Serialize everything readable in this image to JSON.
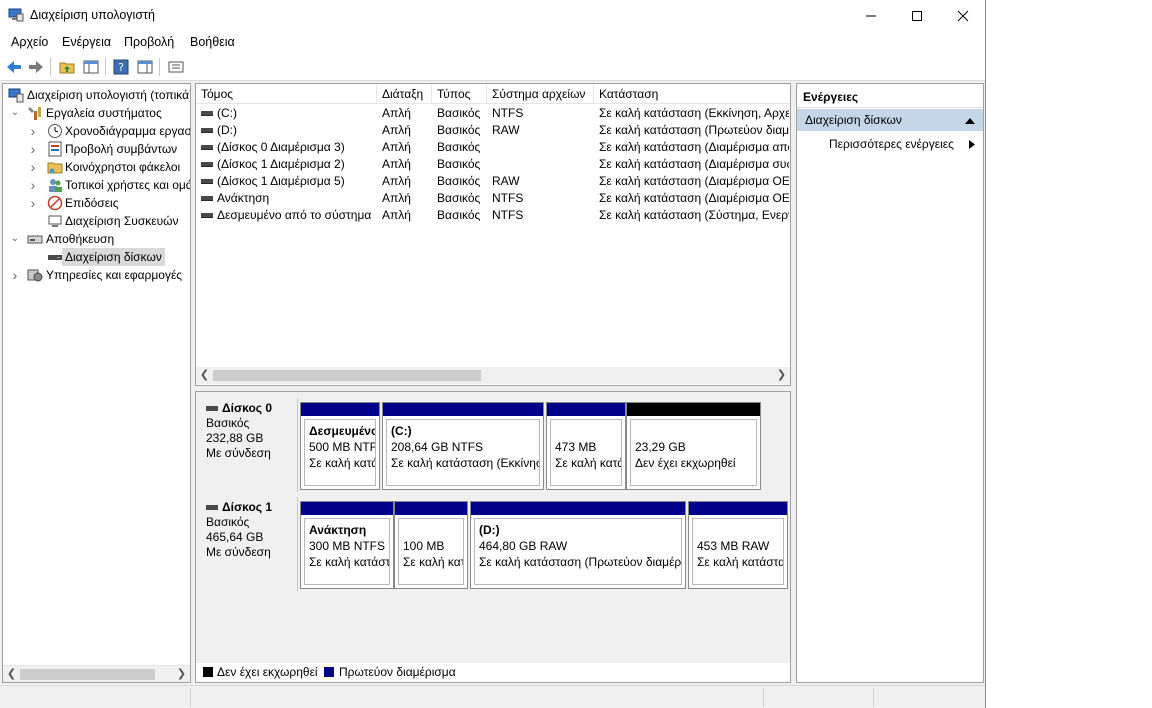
{
  "window": {
    "title": "Διαχείριση υπολογιστή"
  },
  "menu": [
    "Αρχείο",
    "Ενέργεια",
    "Προβολή",
    "Βοήθεια"
  ],
  "tree": [
    {
      "label": "Διαχείριση υπολογιστή (τοπικά)",
      "level": 0,
      "chevron": "",
      "icon": "computer-management-icon"
    },
    {
      "label": "Εργαλεία συστήματος",
      "level": 1,
      "chevron": "down",
      "icon": "tools-icon"
    },
    {
      "label": "Χρονοδιάγραμμα εργασιών",
      "level": 2,
      "chevron": "right",
      "icon": "clock-icon"
    },
    {
      "label": "Προβολή συμβάντων",
      "level": 2,
      "chevron": "right",
      "icon": "event-viewer-icon"
    },
    {
      "label": "Κοινόχρηστοι φάκελοι",
      "level": 2,
      "chevron": "right",
      "icon": "shared-folder-icon"
    },
    {
      "label": "Τοπικοί χρήστες και ομάδες",
      "level": 2,
      "chevron": "right",
      "icon": "users-icon"
    },
    {
      "label": "Επιδόσεις",
      "level": 2,
      "chevron": "right",
      "icon": "performance-icon"
    },
    {
      "label": "Διαχείριση Συσκευών",
      "level": 2,
      "chevron": "",
      "icon": "device-manager-icon"
    },
    {
      "label": "Αποθήκευση",
      "level": 1,
      "chevron": "down",
      "icon": "storage-icon"
    },
    {
      "label": "Διαχείριση δίσκων",
      "level": 2,
      "chevron": "",
      "icon": "disk-icon",
      "selected": true
    },
    {
      "label": "Υπηρεσίες και εφαρμογές",
      "level": 1,
      "chevron": "right",
      "icon": "services-icon"
    }
  ],
  "volumes": {
    "columns": [
      "Τόμος",
      "Διάταξη",
      "Τύπος",
      "Σύστημα αρχείων",
      "Κατάσταση"
    ],
    "rows": [
      [
        "(C:)",
        "Απλή",
        "Βασικός",
        "NTFS",
        "Σε καλή κατάσταση (Εκκίνηση, Αρχε"
      ],
      [
        "(D:)",
        "Απλή",
        "Βασικός",
        "RAW",
        "Σε καλή κατάσταση (Πρωτεύον διαμ"
      ],
      [
        "(Δίσκος 0 Διαμέρισμα 3)",
        "Απλή",
        "Βασικός",
        "",
        "Σε καλή κατάσταση (Διαμέρισμα απο"
      ],
      [
        "(Δίσκος 1 Διαμέρισμα 2)",
        "Απλή",
        "Βασικός",
        "",
        "Σε καλή κατάσταση (Διαμέρισμα συσ"
      ],
      [
        "(Δίσκος 1 Διαμέρισμα 5)",
        "Απλή",
        "Βασικός",
        "RAW",
        "Σε καλή κατάσταση (Διαμέρισμα OEI"
      ],
      [
        "Ανάκτηση",
        "Απλή",
        "Βασικός",
        "NTFS",
        "Σε καλή κατάσταση (Διαμέρισμα OEI"
      ],
      [
        "Δεσμευμένο από το σύστημα",
        "Απλή",
        "Βασικός",
        "NTFS",
        "Σε καλή κατάσταση (Σύστημα, Ενεργ"
      ]
    ]
  },
  "disks": [
    {
      "name": "Δίσκος 0",
      "type": "Βασικός",
      "size": "232,88 GB",
      "status": "Με σύνδεση",
      "partitions": [
        {
          "name": "Δεσμευμένο",
          "line1": "500 MB NTFS",
          "line2": "Σε καλή κατάσταση",
          "bar": "#00008b"
        },
        {
          "name": "(C:)",
          "line1": "208,64 GB NTFS",
          "line2": "Σε καλή κατάσταση (Εκκίνηση",
          "bar": "#00008b"
        },
        {
          "name": "",
          "line1": "473 MB",
          "line2": "Σε καλή κατάσταση",
          "bar": "#00008b"
        },
        {
          "name": "",
          "line1": "23,29 GB",
          "line2": "Δεν έχει εκχωρηθεί",
          "bar": "#000000"
        }
      ]
    },
    {
      "name": "Δίσκος 1",
      "type": "Βασικός",
      "size": "465,64 GB",
      "status": "Με σύνδεση",
      "partitions": [
        {
          "name": "Ανάκτηση",
          "line1": "300 MB NTFS",
          "line2": "Σε καλή κατάσταση",
          "bar": "#00008b"
        },
        {
          "name": "",
          "line1": "100 MB",
          "line2": "Σε καλή κατάσταση",
          "bar": "#00008b"
        },
        {
          "name": "(D:)",
          "line1": "464,80 GB RAW",
          "line2": "Σε καλή κατάσταση (Πρωτεύον διαμέρισμα",
          "bar": "#00008b"
        },
        {
          "name": "",
          "line1": "453 MB RAW",
          "line2": "Σε καλή κατάσταση",
          "bar": "#00008b"
        }
      ]
    }
  ],
  "legend": [
    {
      "label": "Δεν έχει εκχωρηθεί",
      "color": "#000000"
    },
    {
      "label": "Πρωτεύον διαμέρισμα",
      "color": "#00008b"
    }
  ],
  "actions": {
    "header": "Ενέργειες",
    "section": "Διαχείριση δίσκων",
    "item": "Περισσότερες ενέργειες"
  }
}
